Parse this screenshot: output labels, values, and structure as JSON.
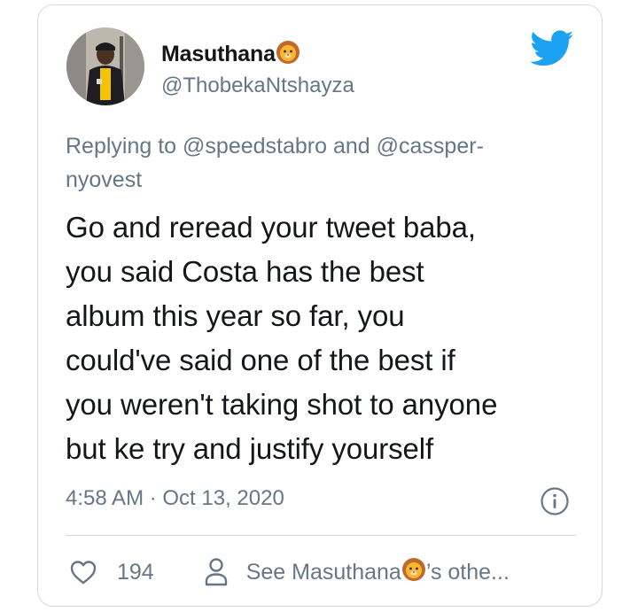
{
  "tweet": {
    "display_name": "Masuthana",
    "name_emoji": "lion-face-emoji",
    "handle": "@ThobekaNtshayza",
    "replying_prefix": "Replying to",
    "replying_to_1": "@speedstabro",
    "replying_and": "and",
    "replying_to_2": "@cassper­nyovest",
    "text_lines": [
      "Go and reread your tweet baba,",
      "you said Costa has the best",
      "album this year so far, you",
      "could've said one of the best if",
      "you weren't taking shot to anyone",
      "but ke try and justify yourself"
    ],
    "timestamp": "4:58 AM · Oct 13, 2020"
  },
  "actions": {
    "like_count": "194",
    "profile_link_prefix": "See Masuthana",
    "profile_link_suffix": "’s othe..."
  },
  "colors": {
    "brand_blue": "#1da1f2",
    "muted_text": "#657786",
    "main_text": "#14171a",
    "border": "#cfd9de"
  },
  "icons": [
    "twitter-bird-icon",
    "info-icon",
    "heart-icon",
    "person-icon"
  ]
}
